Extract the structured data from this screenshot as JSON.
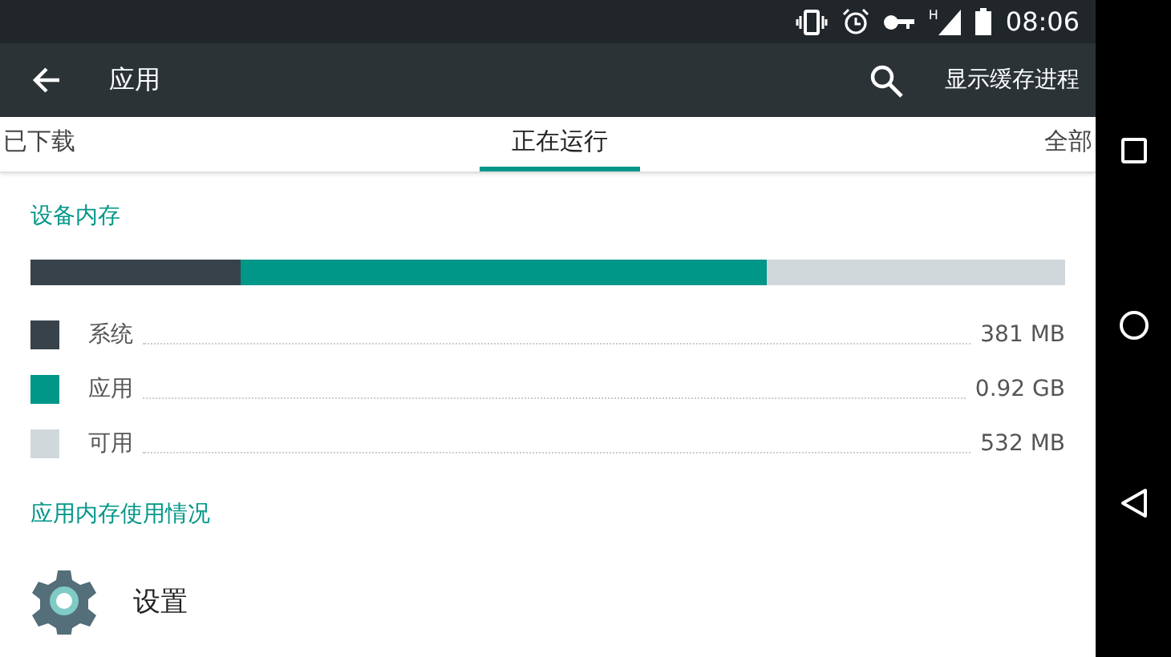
{
  "status_bar": {
    "time": "08:06",
    "network": "H"
  },
  "toolbar": {
    "title": "应用",
    "action": "显示缓存进程"
  },
  "tabs": [
    {
      "label": "已下载",
      "selected": false
    },
    {
      "label": "正在运行",
      "selected": true
    },
    {
      "label": "全部",
      "selected": false
    }
  ],
  "memory": {
    "title": "设备内存",
    "segments": [
      {
        "name": "系统",
        "value": "381 MB",
        "level": 0.203,
        "color": "#37424a"
      },
      {
        "name": "应用",
        "value": "0.92 GB",
        "level": 0.712,
        "color": "#009688"
      },
      {
        "name": "可用",
        "value": "532 MB",
        "color": "#d0d8dc"
      }
    ]
  },
  "app_memory": {
    "title": "应用内存使用情况",
    "apps": [
      {
        "name": "设置"
      }
    ]
  }
}
